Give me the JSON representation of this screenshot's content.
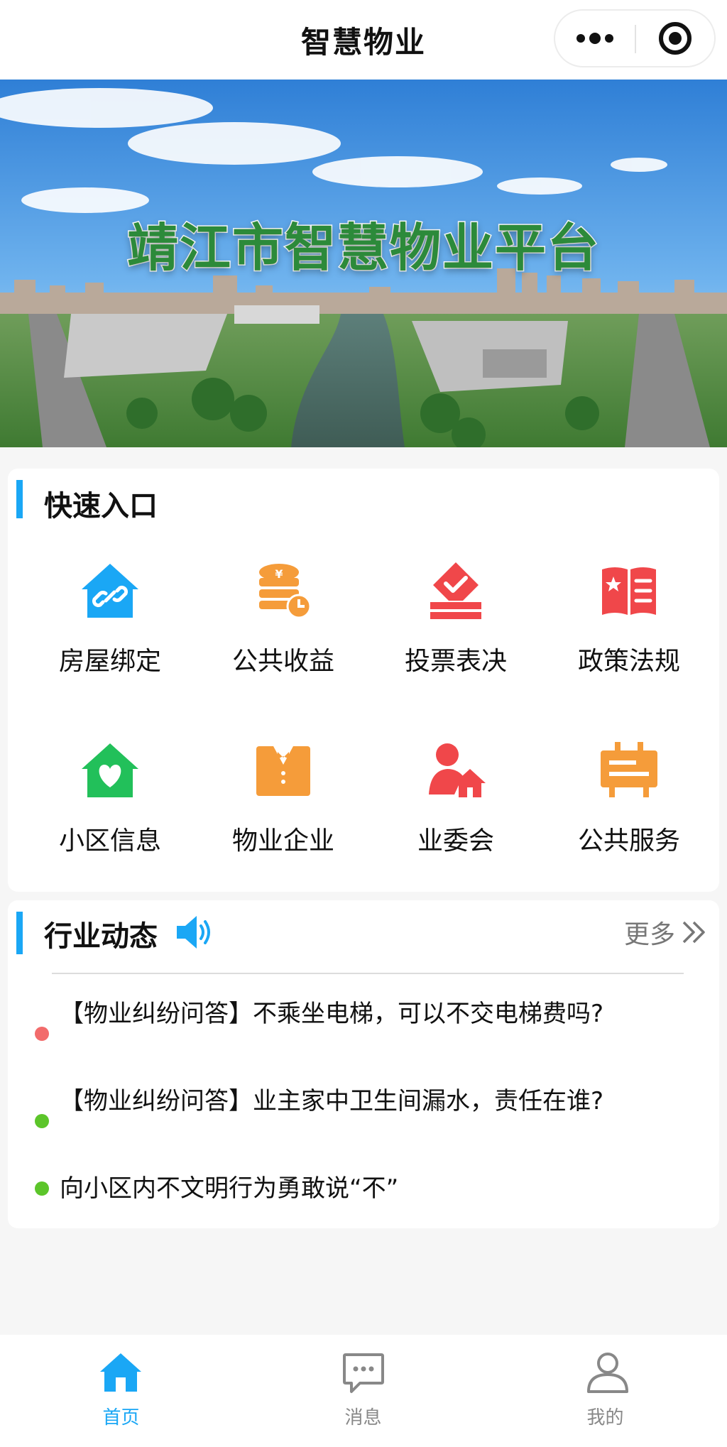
{
  "header": {
    "title": "智慧物业",
    "more_icon": "more-dots-icon",
    "close_icon": "target-icon"
  },
  "banner": {
    "title": "靖江市智慧物业平台"
  },
  "quick_entry": {
    "title": "快速入口",
    "items": [
      {
        "label": "房屋绑定",
        "icon": "house-link-icon",
        "color": "#1aa7f5"
      },
      {
        "label": "公共收益",
        "icon": "coins-icon",
        "color": "#f59c3a"
      },
      {
        "label": "投票表决",
        "icon": "ballot-icon",
        "color": "#f0474a"
      },
      {
        "label": "政策法规",
        "icon": "book-icon",
        "color": "#f0474a"
      },
      {
        "label": "小区信息",
        "icon": "house-heart-icon",
        "color": "#22c05a"
      },
      {
        "label": "物业企业",
        "icon": "suit-icon",
        "color": "#f59c3a"
      },
      {
        "label": "业委会",
        "icon": "person-house-icon",
        "color": "#f0474a"
      },
      {
        "label": "公共服务",
        "icon": "signboard-icon",
        "color": "#f59c3a"
      }
    ]
  },
  "news": {
    "title": "行业动态",
    "more_label": "更多",
    "items": [
      {
        "text": "【物业纠纷问答】不乘坐电梯，可以不交电梯费吗?",
        "dot_color": "#f26b6b"
      },
      {
        "text": "【物业纠纷问答】业主家中卫生间漏水，责任在谁?",
        "dot_color": "#5cc52a"
      },
      {
        "text": "向小区内不文明行为勇敢说“不”",
        "dot_color": "#5cc52a"
      }
    ]
  },
  "tabbar": {
    "tabs": [
      {
        "label": "首页",
        "icon": "home-icon",
        "active": true
      },
      {
        "label": "消息",
        "icon": "message-icon",
        "active": false
      },
      {
        "label": "我的",
        "icon": "user-icon",
        "active": false
      }
    ],
    "active_color": "#1aa7f5",
    "inactive_color": "#888888"
  }
}
